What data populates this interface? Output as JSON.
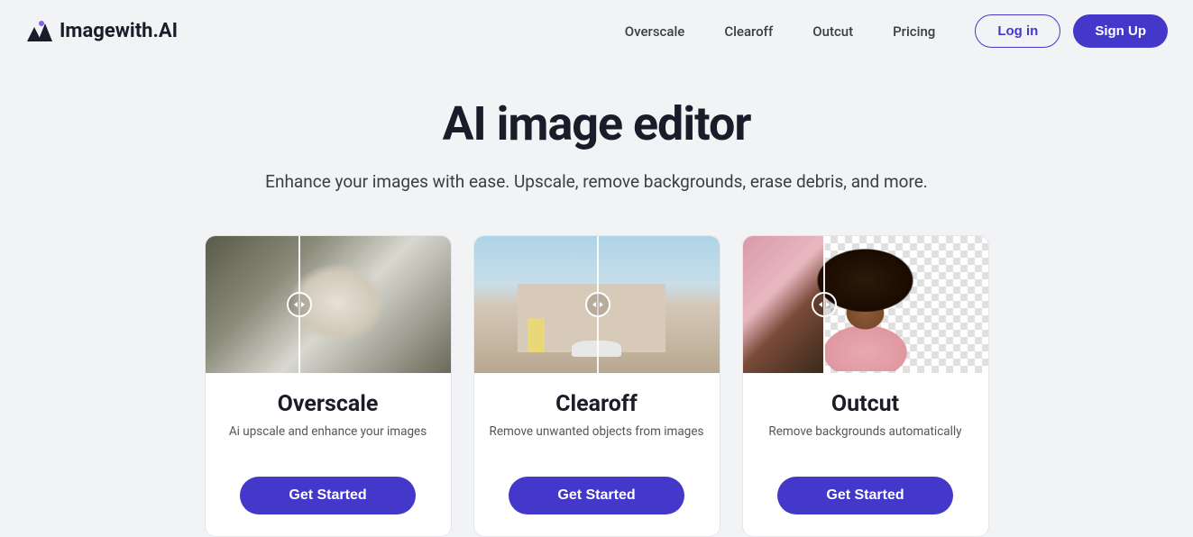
{
  "brand": "Imagewith.AI",
  "nav": {
    "items": [
      "Overscale",
      "Clearoff",
      "Outcut",
      "Pricing"
    ]
  },
  "auth": {
    "login": "Log in",
    "signup": "Sign Up"
  },
  "hero": {
    "title": "AI image editor",
    "subtitle": "Enhance your images with ease. Upscale, remove backgrounds, erase debris, and more."
  },
  "cards": [
    {
      "title": "Overscale",
      "desc": "Ai upscale and enhance your images",
      "button": "Get Started"
    },
    {
      "title": "Clearoff",
      "desc": "Remove unwanted objects from images",
      "button": "Get Started"
    },
    {
      "title": "Outcut",
      "desc": "Remove backgrounds automatically",
      "button": "Get Started"
    }
  ]
}
